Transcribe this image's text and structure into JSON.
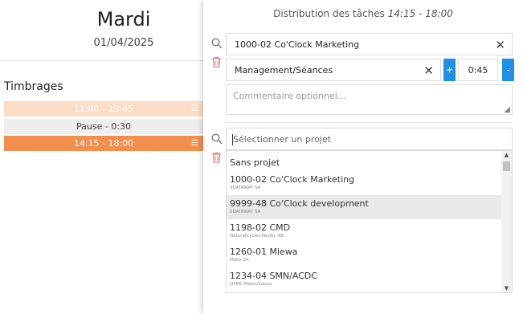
{
  "day": {
    "name": "Mardi",
    "date": "01/04/2025",
    "section_title": "Timbrages",
    "slots": [
      {
        "label": "11:00 - 13:45"
      },
      {
        "label": "Pause - 0:30"
      },
      {
        "label": "14:15 - 18:00"
      }
    ]
  },
  "panel": {
    "title": "Distribution des tâches",
    "title_range": "14:15 - 18:00"
  },
  "allocation": {
    "project": "1000-02 Co'Clock Marketing",
    "task": "Management/Séances",
    "duration": "0:45",
    "plus_label": "+",
    "minus_label": "-",
    "comment_placeholder": "Commentaire optionnel..."
  },
  "project_select": {
    "placeholder": "Sélectionner un projet",
    "options": [
      {
        "name": "Sans projet",
        "client": ""
      },
      {
        "name": "1000-02 Co'Clock Marketing",
        "client": "SDATAWAY SA"
      },
      {
        "name": "9999-48 Co'Clock development",
        "client": "SDATAWAY SA"
      },
      {
        "name": "1198-02 CMD",
        "client": "NaturalCycles Nordic AB"
      },
      {
        "name": "1260-01 Miewa",
        "client": "Matis SA"
      },
      {
        "name": "1234-04 SMN/ACDC",
        "client": "OFMC MétéoSuisse"
      }
    ],
    "highlighted_index": 2
  },
  "colors": {
    "accent": "#f28f4e",
    "accent_light": "#fbdcc6",
    "button_blue": "#1e90e8",
    "delete_red": "#e47a7a"
  }
}
